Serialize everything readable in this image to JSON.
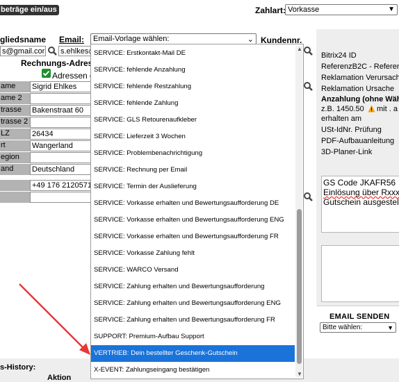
{
  "topbar": {
    "toggle_button": "beträge ein/aus",
    "payment_label": "Zahlart:",
    "payment_value": "Vorkasse"
  },
  "header": {
    "member_name_label": "gliedsname",
    "email_label": "Email:",
    "email_template_select": "Email-Vorlage wählen:",
    "customer_no_label": "Kundennr."
  },
  "emails": {
    "field1_value": "s@gmail.cor",
    "field2_value": "s.ehlkes@"
  },
  "billing": {
    "heading": "Rechnungs-Adress",
    "checkbox_label": "Adressen d",
    "rows": [
      {
        "label": "ame",
        "value": "Sigrid Ehlkes"
      },
      {
        "label": "ame 2",
        "value": ""
      },
      {
        "label": "trasse",
        "value": "Bakenstraat 60"
      },
      {
        "label": "trasse 2",
        "value": ""
      },
      {
        "label": "LZ",
        "value": "26434"
      },
      {
        "label": "rt",
        "value": "Wangerland"
      },
      {
        "label": "egion",
        "value": ""
      },
      {
        "label": "and",
        "value": "Deutschland"
      },
      {
        "label": "",
        "value": "+49 176 2120571"
      },
      {
        "label": "",
        "value": ""
      }
    ]
  },
  "dropdown": {
    "options": [
      "SERVICE: Erstkontakt-Mail DE",
      "SERVICE: fehlende Anzahlung",
      "SERVICE: fehlende Restzahlung",
      "SERVICE: fehlende Zahlung",
      "SERVICE: GLS Retourenaufkleber",
      "SERVICE: Lieferzeit 3 Wochen",
      "SERVICE: Problembenachrichtigung",
      "SERVICE: Rechnung per Email",
      "SERVICE: Termin der Auslieferung",
      "SERVICE: Vorkasse erhalten und Bewertungsaufforderung DE",
      "SERVICE: Vorkasse erhalten und Bewertungsaufforderung ENG",
      "SERVICE: Vorkasse erhalten und Bewertungsaufforderung FR",
      "SERVICE: Vorkasse Zahlung fehlt",
      "SERVICE: WARCO Versand",
      "SERVICE: Zahlung erhalten und Bewertungsaufforderung",
      "SERVICE: Zahlung erhalten und Bewertungsaufforderung ENG",
      "SERVICE: Zahlung erhalten und Bewertungsaufforderung FR",
      "SUPPORT: Premium-Aufbau Support",
      "VERTRIEB: Dein bestellter Geschenk-Gutschein",
      "X-EVENT: Zahlungseingang bestätigen"
    ],
    "selected_index": 18
  },
  "right_panel": {
    "lines": [
      "Bitrix24 ID",
      "ReferenzB2C - Referenz",
      "Reklamation Verursacher",
      "Reklamation Ursache",
      "Anzahlung (ohne Wäh",
      "z.B. 1450.50",
      "mit . a",
      "erhalten am",
      "USt-IdNr. Prüfung",
      "PDF-Aufbauanleitung",
      "3D-Planer-Link"
    ],
    "textarea_lines": [
      "GS Code  JKAFR56",
      "Einlösung über Rxxx",
      "Gutschein ausgestel"
    ],
    "email_send_label": "EMAIL SENDEN",
    "email_send_select": "Bitte wählen:"
  },
  "footer": {
    "history_label": "s-History:",
    "action_label": "Aktion"
  },
  "colors": {
    "selected_option_bg": "#1a73d9",
    "label_bg": "#b3b3b3",
    "annotation_arrow": "#e53935",
    "warning_icon": "#f4a300"
  }
}
